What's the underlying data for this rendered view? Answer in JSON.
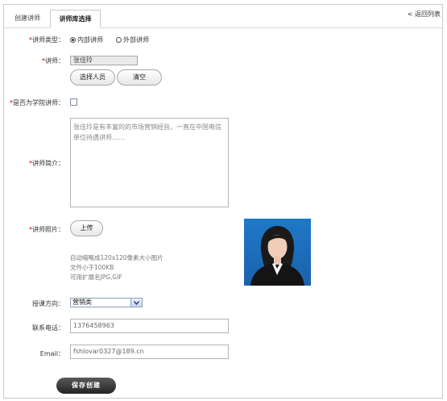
{
  "tabs": [
    {
      "label": "创建讲师",
      "active": false
    },
    {
      "label": "讲师库选择",
      "active": true
    }
  ],
  "back_link": "< 返回列表",
  "form": {
    "type": {
      "label": "讲师类型：",
      "options": [
        "内部讲师",
        "外部讲师"
      ],
      "selected": "内部讲师"
    },
    "teacher": {
      "label": "讲师：",
      "value": "张佳玲",
      "select_button": "选择人员",
      "clear_button": "清空"
    },
    "academy": {
      "label": "是否为学院讲师：",
      "checked": false
    },
    "intro": {
      "label": "讲师简介：",
      "text": "张佳玲是有丰富的的市场营销经验，一直在中国电信单位待遇讲师……"
    },
    "photo": {
      "label": "讲师照片：",
      "upload_button": "上传",
      "hint_lines": [
        "自动缩略成120x120像素大小图片",
        "文件小于100KB",
        "可用扩展名JPG,GIF"
      ]
    },
    "direction": {
      "label": "授课方向：",
      "value": "营销类"
    },
    "phone": {
      "label": "联系电话：",
      "value": "1376458963"
    },
    "email": {
      "label": "Email：",
      "value": "fshlovar0327@189.cn"
    },
    "save_button": "保存创建"
  },
  "colors": {
    "required": "#d00000",
    "save_bg": "#2b2b2b"
  }
}
